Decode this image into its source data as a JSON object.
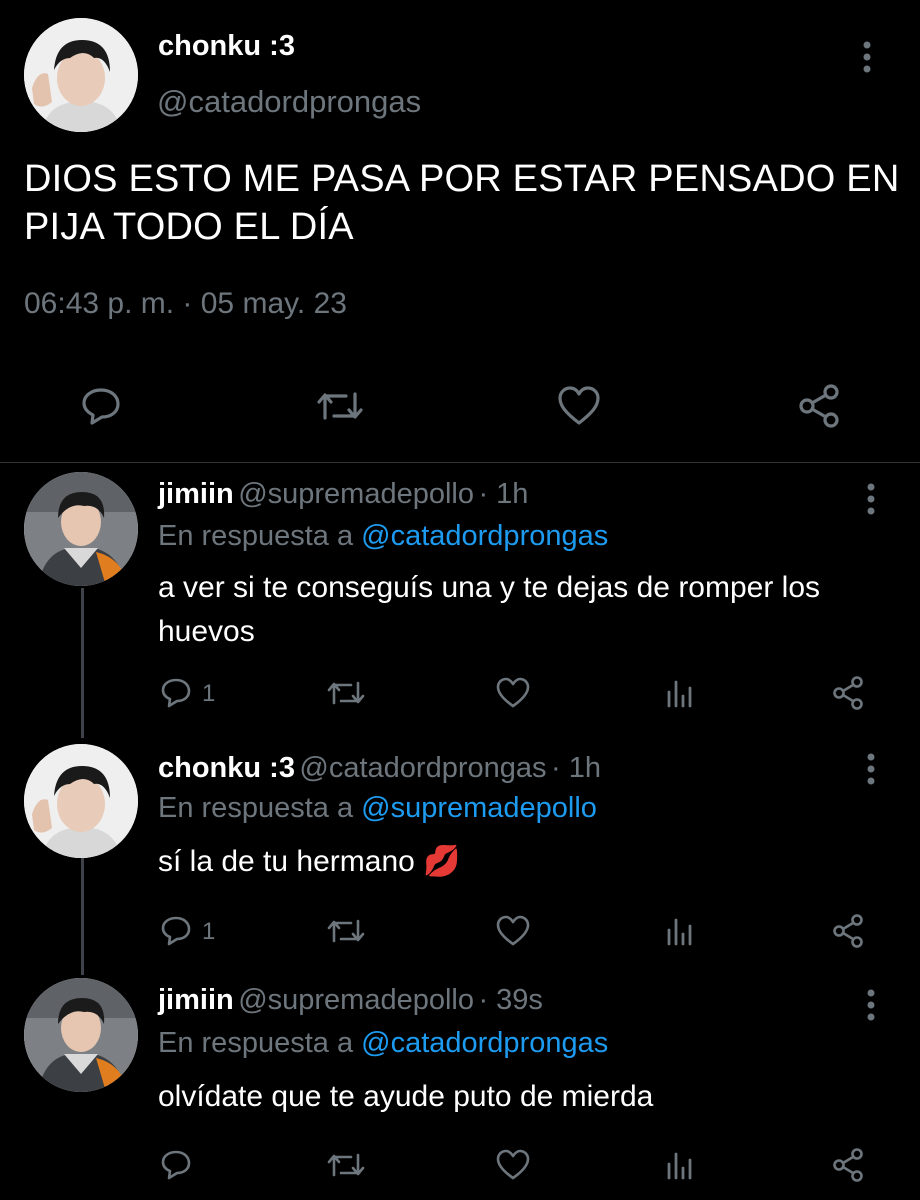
{
  "main_tweet": {
    "author_name": "chonku :3",
    "author_handle": "@catadordprongas",
    "text": "DIOS ESTO ME PASA POR ESTAR PENSADO EN PIJA TODO EL DÍA",
    "timestamp": "06:43 p. m. · 05 may. 23",
    "actions": [
      "reply-icon",
      "retweet-icon",
      "like-icon",
      "share-icon"
    ]
  },
  "replies": [
    {
      "author_name": "jimiin",
      "author_handle": "@supremadepollo",
      "age": "· 1h",
      "reply_prefix": "En respuesta a",
      "reply_to": "@catadordprongas",
      "text": "a ver si te conseguís una y te dejas de romper los huevos",
      "reply_count": "1"
    },
    {
      "author_name": "chonku :3",
      "author_handle": "@catadordprongas",
      "age": "· 1h",
      "reply_prefix": "En respuesta a",
      "reply_to": "@supremadepollo",
      "text": "sí la de tu hermano",
      "emoji": "💋",
      "reply_count": "1"
    },
    {
      "author_name": "jimiin",
      "author_handle": "@supremadepollo",
      "age": "· 39s",
      "reply_prefix": "En respuesta a",
      "reply_to": "@catadordprongas",
      "text": "olvídate que te ayude puto de mierda",
      "reply_count": ""
    }
  ],
  "colors": {
    "background": "#000000",
    "text": "#ffffff",
    "muted": "#6e767d",
    "link": "#1d9bf0",
    "thread_line": "#3d4348"
  }
}
